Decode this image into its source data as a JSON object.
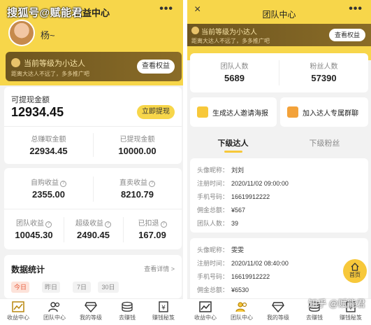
{
  "watermark": {
    "top_left": "搜狐号@赋能君",
    "bottom_right": "知乎 @赋能君"
  },
  "left": {
    "title": "收益中心",
    "username": "杨~",
    "level": {
      "text": "当前等级为小达人",
      "sub": "距离大达人不远了，多多推广吧",
      "button": "查看权益"
    },
    "withdrawable": {
      "label": "可提现金额",
      "value": "12934.45",
      "button": "立即提现"
    },
    "total_earned": {
      "label": "总赚取金额",
      "value": "22934.45"
    },
    "withdrawn": {
      "label": "已提现金额",
      "value": "10000.00"
    },
    "self_purchase": {
      "label": "自购收益",
      "value": "2355.00"
    },
    "direct_sale": {
      "label": "直卖收益",
      "value": "8210.79"
    },
    "team_income": {
      "label": "团队收益",
      "value": "10045.30"
    },
    "super_income": {
      "label": "超级收益",
      "value": "2490.45"
    },
    "deducted": {
      "label": "已扣退",
      "value": "167.09"
    },
    "stats": {
      "title": "数据统计",
      "more": "查看详情 >",
      "chips": [
        "今日",
        "昨日",
        "7日",
        "30日"
      ]
    },
    "tabbar": [
      "收益中心",
      "团队中心",
      "我的等级",
      "去赚钱",
      "赚钱秘笈"
    ]
  },
  "right": {
    "close": "×",
    "title": "团队中心",
    "level": {
      "text": "当前等级为小达人",
      "sub": "距离大达人不远了，多多推广吧",
      "button": "查看权益"
    },
    "team_count": {
      "label": "团队人数",
      "value": "5689"
    },
    "fans_count": {
      "label": "粉丝人数",
      "value": "57390"
    },
    "actions": [
      "生成达人邀请海报",
      "加入达人专属群聊"
    ],
    "subtabs": [
      "下级达人",
      "下级粉丝"
    ],
    "members": [
      {
        "nickname_label": "头像昵称：",
        "nickname": "刘刘",
        "reg_label": "注册时间：",
        "reg": "2020/11/02 09:00:00",
        "phone_label": "手机号码：",
        "phone": "16619912222",
        "commission_label": "佣金总额：",
        "commission": "¥567",
        "team_label": "团队人数：",
        "team": "39"
      },
      {
        "nickname_label": "头像昵称：",
        "nickname": "雯雯",
        "reg_label": "注册时间：",
        "reg": "2020/11/02 08:40:00",
        "phone_label": "手机号码：",
        "phone": "16619912222",
        "commission_label": "佣金总额：",
        "commission": "¥6530"
      }
    ],
    "fab_label": "首页",
    "tabbar": [
      "收益中心",
      "团队中心",
      "我的等级",
      "去赚钱",
      "赚钱秘笈"
    ]
  },
  "colors": {
    "accent": "#f7d64a",
    "level_bg": "#7a6024",
    "chip_active": "#e65a3a"
  }
}
